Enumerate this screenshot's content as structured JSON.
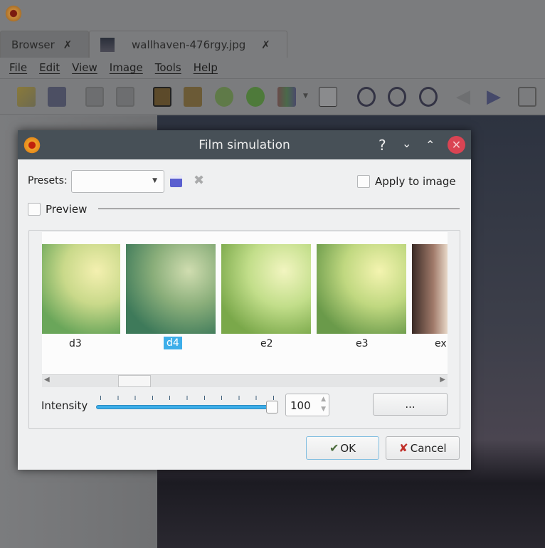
{
  "app": {
    "tabs": [
      {
        "label": "Browser"
      },
      {
        "label": "wallhaven-476rgy.jpg"
      }
    ],
    "menu": [
      "File",
      "Edit",
      "View",
      "Image",
      "Tools",
      "Help"
    ],
    "toolbar_icons": [
      "browser-tree-icon",
      "save-icon",
      "undo-icon",
      "redo-icon",
      "crop-icon",
      "resize-icon",
      "rotate-left-icon",
      "rotate-right-icon",
      "adjust-colors-icon",
      "levels-icon",
      "zoom-in-icon",
      "zoom-actual-icon",
      "zoom-out-icon",
      "previous-icon",
      "next-icon",
      "fullscreen-icon"
    ]
  },
  "dialog": {
    "title": "Film simulation",
    "presets_label": "Presets:",
    "presets_value": "",
    "apply_label": "Apply to image",
    "preview_label": "Preview",
    "films": [
      {
        "label": "d3"
      },
      {
        "label": "d4",
        "selected": true
      },
      {
        "label": "e2"
      },
      {
        "label": "e3"
      },
      {
        "label": "ex"
      }
    ],
    "intensity_label": "Intensity",
    "intensity_value": "100",
    "intensity_percent": 100,
    "more_label": "...",
    "ok_label": "OK",
    "cancel_label": "Cancel"
  },
  "colors": {
    "accent": "#3daee9",
    "close": "#da4453",
    "titlebar": "#475057"
  }
}
